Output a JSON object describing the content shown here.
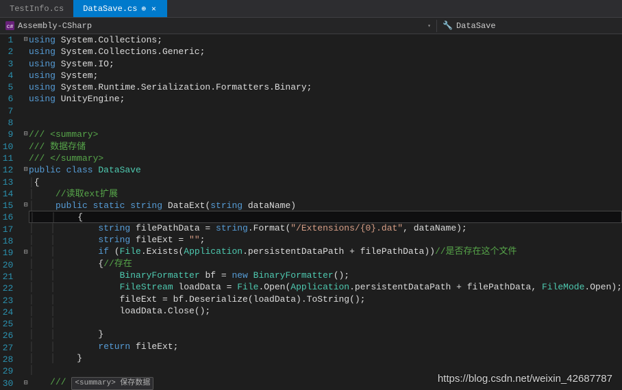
{
  "tabs": {
    "inactive": "TestInfo.cs",
    "active": "DataSave.cs"
  },
  "breadcrumb": {
    "project": "Assembly-CSharp",
    "class": "DataSave"
  },
  "gutter": {
    "start": 1,
    "end": 30
  },
  "code": {
    "l1": {
      "pre": "",
      "k1": "using",
      "t": " System.Collections",
      "e": ";"
    },
    "l2": {
      "pre": "",
      "k1": "using",
      "t": " System.Collections.Generic",
      "e": ";"
    },
    "l3": {
      "pre": "",
      "k1": "using",
      "t": " System.IO",
      "e": ";"
    },
    "l4": {
      "pre": "",
      "k1": "using",
      "t": " System",
      "e": ";"
    },
    "l5": {
      "pre": "",
      "k1": "using",
      "t": " System.Runtime.Serialization.Formatters.Binary",
      "e": ";"
    },
    "l6": {
      "pre": "",
      "k1": "using",
      "t": " UnityEngine",
      "e": ";"
    },
    "l9": {
      "c": "/// <summary>"
    },
    "l10": {
      "c": "/// 数据存储"
    },
    "l11": {
      "c": "/// </summary>"
    },
    "l12": {
      "k1": "public",
      "k2": " class ",
      "t": "DataSave"
    },
    "l13": {
      "p": "{"
    },
    "l14": {
      "pre": "    ",
      "c": "//读取ext扩展"
    },
    "l15": {
      "pre": "    ",
      "k": "public static string ",
      "m": "DataExt",
      "p1": "(",
      "k2": "string",
      "p2": " dataName)"
    },
    "l16": {
      "pre": "    ",
      "p": "{"
    },
    "l17": {
      "pre": "        ",
      "k": "string",
      "p1": " filePathData = ",
      "k2": "string",
      "p2": ".Format(",
      "s": "\"/Extensions/{0}.dat\"",
      "p3": ", dataName);"
    },
    "l18": {
      "pre": "        ",
      "k": "string",
      "p1": " fileExt = ",
      "s": "\"\"",
      "p2": ";"
    },
    "l19": {
      "pre": "        ",
      "k": "if",
      "p1": " (",
      "t1": "File",
      "p2": ".Exists(",
      "t2": "Application",
      "p3": ".persistentDataPath + filePathData))",
      "c": "//是否存在这个文件"
    },
    "l20": {
      "pre": "        ",
      "p": "{",
      "c": "//存在"
    },
    "l21": {
      "pre": "            ",
      "t1": "BinaryFormatter",
      "p1": " bf = ",
      "k": "new",
      "p2": " ",
      "t2": "BinaryFormatter",
      "p3": "();"
    },
    "l22": {
      "pre": "            ",
      "t1": "FileStream",
      "p1": " loadData = ",
      "t2": "File",
      "p2": ".Open(",
      "t3": "Application",
      "p3": ".persistentDataPath + filePathData, ",
      "t4": "FileMode",
      "p4": ".Open);"
    },
    "l23": {
      "pre": "            ",
      "p": "fileExt = bf.Deserialize(loadData).ToString();"
    },
    "l24": {
      "pre": "            ",
      "p": "loadData.Close();"
    },
    "l26": {
      "pre": "        ",
      "p": "}"
    },
    "l27": {
      "pre": "        ",
      "k": "return",
      "p": " fileExt;"
    },
    "l28": {
      "pre": "    ",
      "p": "}"
    },
    "l30": {
      "tip": "<summary> 保存数据"
    }
  },
  "watermark": "https://blog.csdn.net/weixin_42687787"
}
